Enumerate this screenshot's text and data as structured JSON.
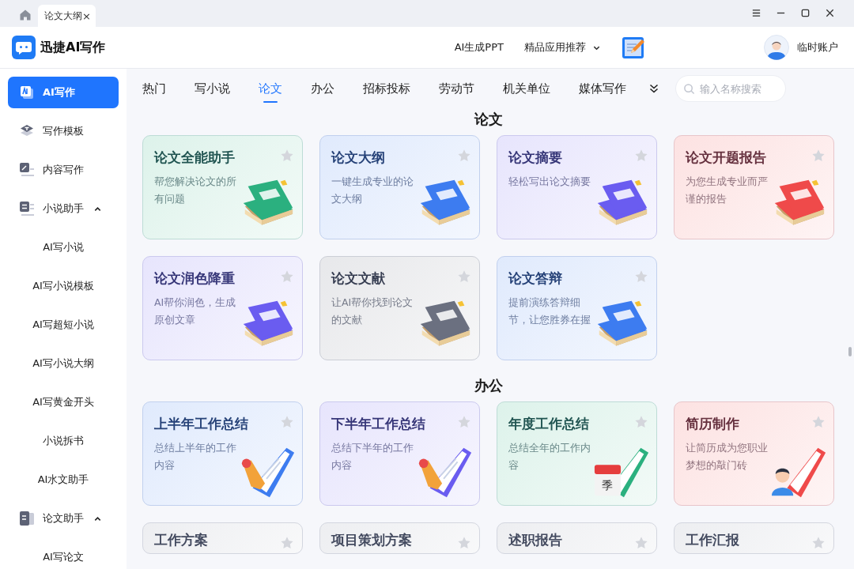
{
  "browser_tabs": [
    {
      "label": "论文大纲",
      "close": "×",
      "selected": true
    }
  ],
  "app": {
    "name": "迅捷AI写作"
  },
  "header": {
    "links": [
      {
        "label": "AI生成PPT",
        "kind": "link"
      },
      {
        "label": "精品应用推荐",
        "kind": "dropdown"
      }
    ],
    "account": "临时账户"
  },
  "sidebar": {
    "items": [
      {
        "label": "AI写作",
        "kind": "primary",
        "selected": true
      },
      {
        "label": "写作模板",
        "kind": "template",
        "selected": false
      },
      {
        "label": "内容写作",
        "kind": "edit",
        "selected": false
      },
      {
        "label": "小说助手",
        "kind": "list",
        "selected": false,
        "expanded": true,
        "children": [
          {
            "label": "AI写小说",
            "selected": false
          },
          {
            "label": "AI写小说模板",
            "selected": false
          },
          {
            "label": "AI写超短小说",
            "selected": false
          },
          {
            "label": "AI写小说大纲",
            "selected": false
          },
          {
            "label": "AI写黄金开头",
            "selected": false
          },
          {
            "label": "小说拆书",
            "selected": false
          },
          {
            "label": "AI水文助手",
            "selected": false
          }
        ]
      },
      {
        "label": "论文助手",
        "kind": "doc",
        "selected": false,
        "expanded": true,
        "children": [
          {
            "label": "AI写论文",
            "selected": false
          }
        ]
      }
    ]
  },
  "category_tabs": [
    {
      "label": "热门",
      "selected": false
    },
    {
      "label": "写小说",
      "selected": false
    },
    {
      "label": "论文",
      "selected": true
    },
    {
      "label": "办公",
      "selected": false
    },
    {
      "label": "招标投标",
      "selected": false
    },
    {
      "label": "劳动节",
      "selected": false
    },
    {
      "label": "机关单位",
      "selected": false
    },
    {
      "label": "媒体写作",
      "selected": false
    }
  ],
  "search": {
    "placeholder": "输入名称搜索"
  },
  "sections": [
    {
      "title": "论文",
      "cards": [
        {
          "title": "论文全能助手",
          "description": "帮您解决论文的所有问题",
          "color": "#2bb07f",
          "kind": "book",
          "favorited": false
        },
        {
          "title": "论文大纲",
          "description": "一键生成专业的论文大纲",
          "color": "#3d7cf0",
          "kind": "book",
          "favorited": false
        },
        {
          "title": "论文摘要",
          "description": "轻松写出论文摘要",
          "color": "#6a5cf0",
          "kind": "book",
          "favorited": false
        },
        {
          "title": "论文开题报告",
          "description": "为您生成专业而严谨的报告",
          "color": "#ef4a4a",
          "kind": "book",
          "favorited": false
        },
        {
          "title": "论文润色降重",
          "description": "AI帮你润色，生成原创文章",
          "color": "#6a5cf0",
          "kind": "book",
          "favorited": false
        },
        {
          "title": "论文文献",
          "description": "让AI帮你找到论文的文献",
          "color": "#6b7080",
          "kind": "book",
          "favorited": false
        },
        {
          "title": "论文答辩",
          "description": "提前演练答辩细节，让您胜券在握",
          "color": "#3d7cf0",
          "kind": "book",
          "favorited": false
        }
      ]
    },
    {
      "title": "办公",
      "cards": [
        {
          "title": "上半年工作总结",
          "description": "总结上半年的工作内容",
          "color": "#3d7cf0",
          "kind": "notepad",
          "favorited": false
        },
        {
          "title": "下半年工作总结",
          "description": "总结下半年的工作内容",
          "color": "#6a5cf0",
          "kind": "notepad",
          "favorited": false
        },
        {
          "title": "年度工作总结",
          "description": "总结全年的工作内容",
          "color": "#2bb07f",
          "kind": "calendar",
          "calendar_label": "季",
          "favorited": false
        },
        {
          "title": "简历制作",
          "description": "让简历成为您职业梦想的敲门砖",
          "color": "#ef4a4a",
          "kind": "person",
          "favorited": false
        },
        {
          "title": "工作方案",
          "kind": "partial",
          "favorited": false
        },
        {
          "title": "项目策划方案",
          "kind": "partial",
          "favorited": false
        },
        {
          "title": "述职报告",
          "kind": "partial",
          "favorited": false
        },
        {
          "title": "工作汇报",
          "kind": "partial",
          "favorited": false
        }
      ]
    }
  ]
}
